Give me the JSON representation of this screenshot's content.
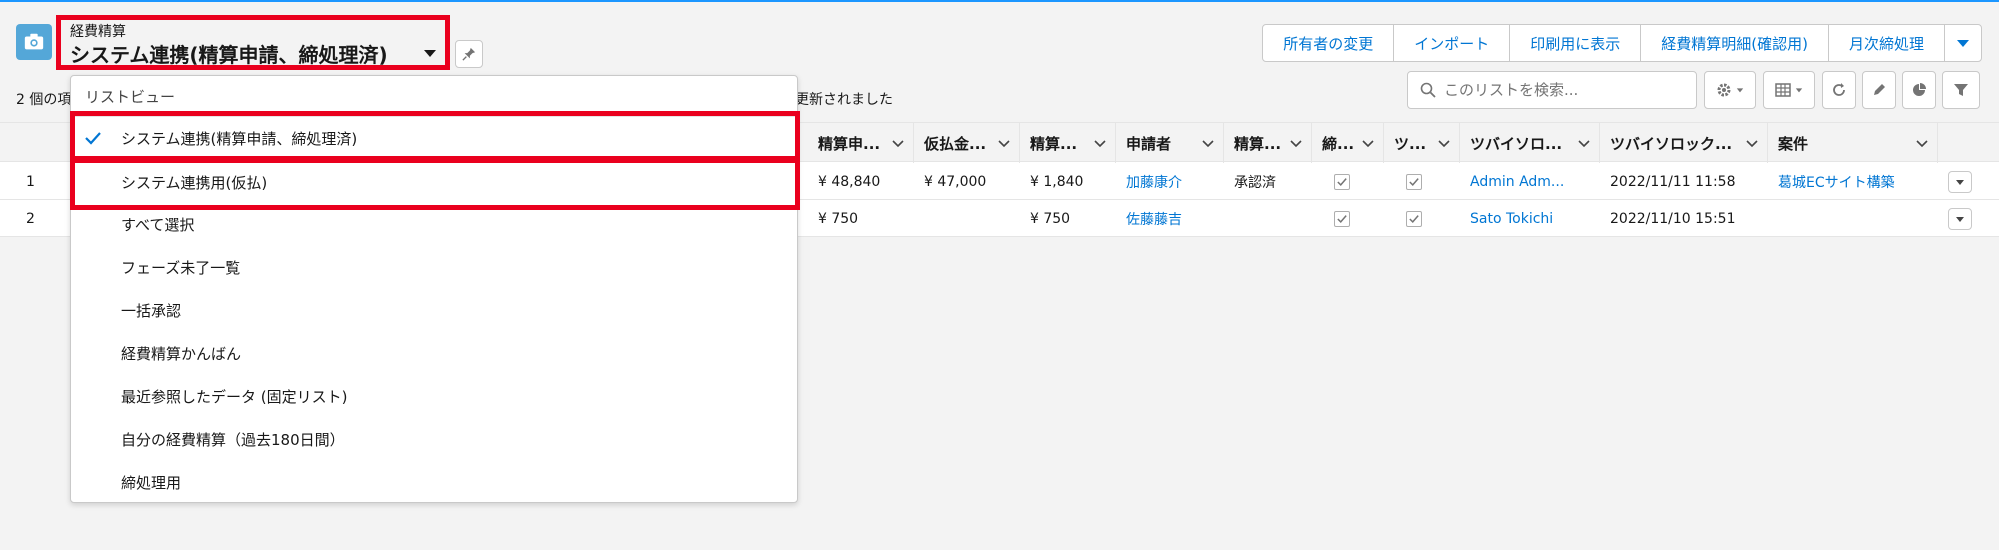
{
  "header": {
    "object_label": "経費精算",
    "list_title": "システム連携(精算申請、締処理済)",
    "actions": [
      "所有者の変更",
      "インポート",
      "印刷用に表示",
      "経費精算明細(確認用)",
      "月次締処理"
    ],
    "meta_left": "2 個の項",
    "meta_right": "更新されました",
    "search_placeholder": "このリストを検索..."
  },
  "columns": [
    "精算申...",
    "仮払金...",
    "精算...",
    "申請者",
    "精算...",
    "締...",
    "ツ...",
    "ツバイソロ...",
    "ツバイソロック...",
    "案件"
  ],
  "rows": [
    {
      "num": "1",
      "amount": "¥ 48,840",
      "advance": "¥ 47,000",
      "settle": "¥ 1,840",
      "applicant": "加藤康介",
      "status": "承認済",
      "user": "Admin Adm...",
      "date": "2022/11/11 11:58",
      "project": "葛城ECサイト構築"
    },
    {
      "num": "2",
      "amount": "¥ 750",
      "advance": "",
      "settle": "¥ 750",
      "applicant": "佐藤藤吉",
      "status": "",
      "user": "Sato Tokichi",
      "date": "2022/11/10 15:51",
      "project": ""
    }
  ],
  "dropdown": {
    "header": "リストビュー",
    "items": [
      "システム連携(精算申請、締処理済)",
      "システム連携用(仮払)",
      "すべて選択",
      "フェーズ未了一覧",
      "一括承認",
      "経費精算かんばん",
      "最近参照したデータ (固定リスト)",
      "自分の経費精算（過去180日間）",
      "締処理用"
    ]
  }
}
